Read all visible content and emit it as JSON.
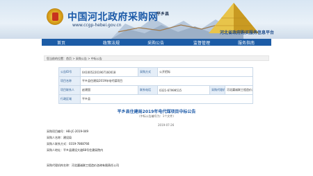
{
  "banner": {
    "site_title": "中国河北政府采购网",
    "site_url": "www.ccgp-hebei.gov.cn",
    "region": "平乡县",
    "brand": "河北省政府购买服务信息平台"
  },
  "nav": {
    "items": [
      "首页",
      "政策法规",
      "采购公告",
      "监督管理",
      "服务指南"
    ]
  },
  "breadcrumb": {
    "text": "您当前的位置：首页 > 采购公告 > 中标公告"
  },
  "info_table": {
    "rows": [
      {
        "l1": "公告ID号",
        "v1": "0410052201907160018",
        "l2": "采购方式",
        "v2": "公开招标"
      },
      {
        "l1": "项目名称",
        "v1": "平乡县住建局2019年电代煤项目",
        "l2": "",
        "v2": ""
      },
      {
        "l1": "项目联系人",
        "v1": "赵建国",
        "l2": "联系电话",
        "v2": "0321-67999515",
        "l3": "采购代理机构",
        "v3": "河北冀诚联工程造价咨询有限责任公司"
      },
      {
        "l1": "行政区域",
        "v1": "平乡县",
        "l2": "",
        "v2": ""
      }
    ]
  },
  "announcement": {
    "title": "平乡县住建局2019年电代煤项目中标公告",
    "subtitle": "(中标公告编号为：1个文件)",
    "date": "2019-07-26",
    "fields": [
      {
        "label": "采购项目编号：",
        "value": "HB-JC-2019-049"
      },
      {
        "label": "采购人名称：",
        "value": "建设局"
      },
      {
        "label": "采购人联系方式：",
        "value": "0319-7868766"
      },
      {
        "label": "采购人地址：",
        "value": "平乡县建设大道68号住建局院内"
      },
      {
        "label": "采购代理机构名称：",
        "value": "河北冀诚联工程造价咨询有限责任公司"
      }
    ]
  }
}
